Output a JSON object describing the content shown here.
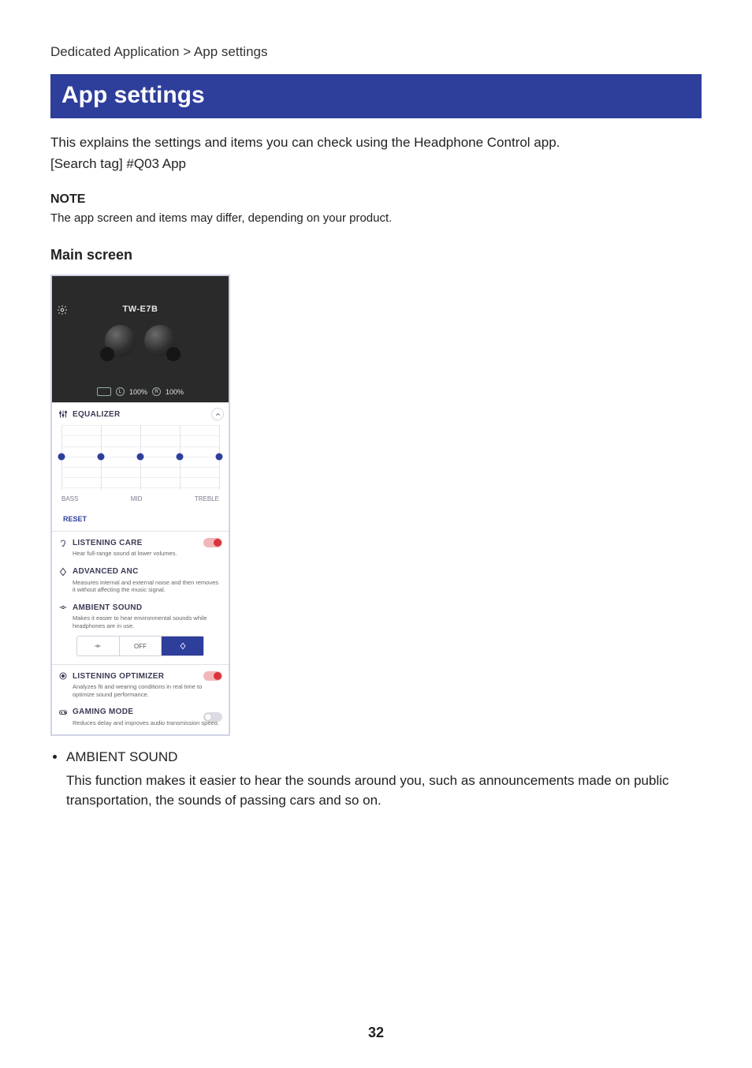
{
  "breadcrumb": "Dedicated Application > App settings",
  "title": "App settings",
  "intro": "This explains the settings and items you can check using the Headphone Control app.",
  "search_tag": "[Search tag] #Q03 App",
  "note": {
    "heading": "NOTE",
    "body": "The app screen and items may differ, depending on your product."
  },
  "section_heading": "Main screen",
  "mock": {
    "model": "TW-E7B",
    "battery": {
      "left": "100%",
      "right": "100%"
    },
    "equalizer": {
      "title": "EQUALIZER",
      "labels": {
        "bass": "BASS",
        "mid": "MID",
        "treble": "TREBLE"
      },
      "reset": "RESET"
    },
    "listening_care": {
      "title": "LISTENING CARE",
      "desc": "Hear full-range sound at lower volumes.",
      "on": true
    },
    "advanced_anc": {
      "title": "ADVANCED ANC",
      "desc": "Measures internal and external noise and then removes it without affecting the music signal."
    },
    "ambient_sound": {
      "title": "AMBIENT SOUND",
      "desc": "Makes it easier to hear environmental sounds while headphones are in use.",
      "segment_center": "OFF"
    },
    "listening_optimizer": {
      "title": "LISTENING OPTIMIZER",
      "desc": "Analyzes fit and wearing conditions in real time to optimize sound performance.",
      "on": true
    },
    "gaming_mode": {
      "title": "GAMING MODE",
      "desc": "Reduces delay and improves audio transmission speed.",
      "on": false
    }
  },
  "bullet": {
    "title": "AMBIENT SOUND",
    "body": "This function makes it easier to hear the sounds around you, such as announcements made on public transportation, the sounds of passing cars and so on."
  },
  "page_number": "32"
}
